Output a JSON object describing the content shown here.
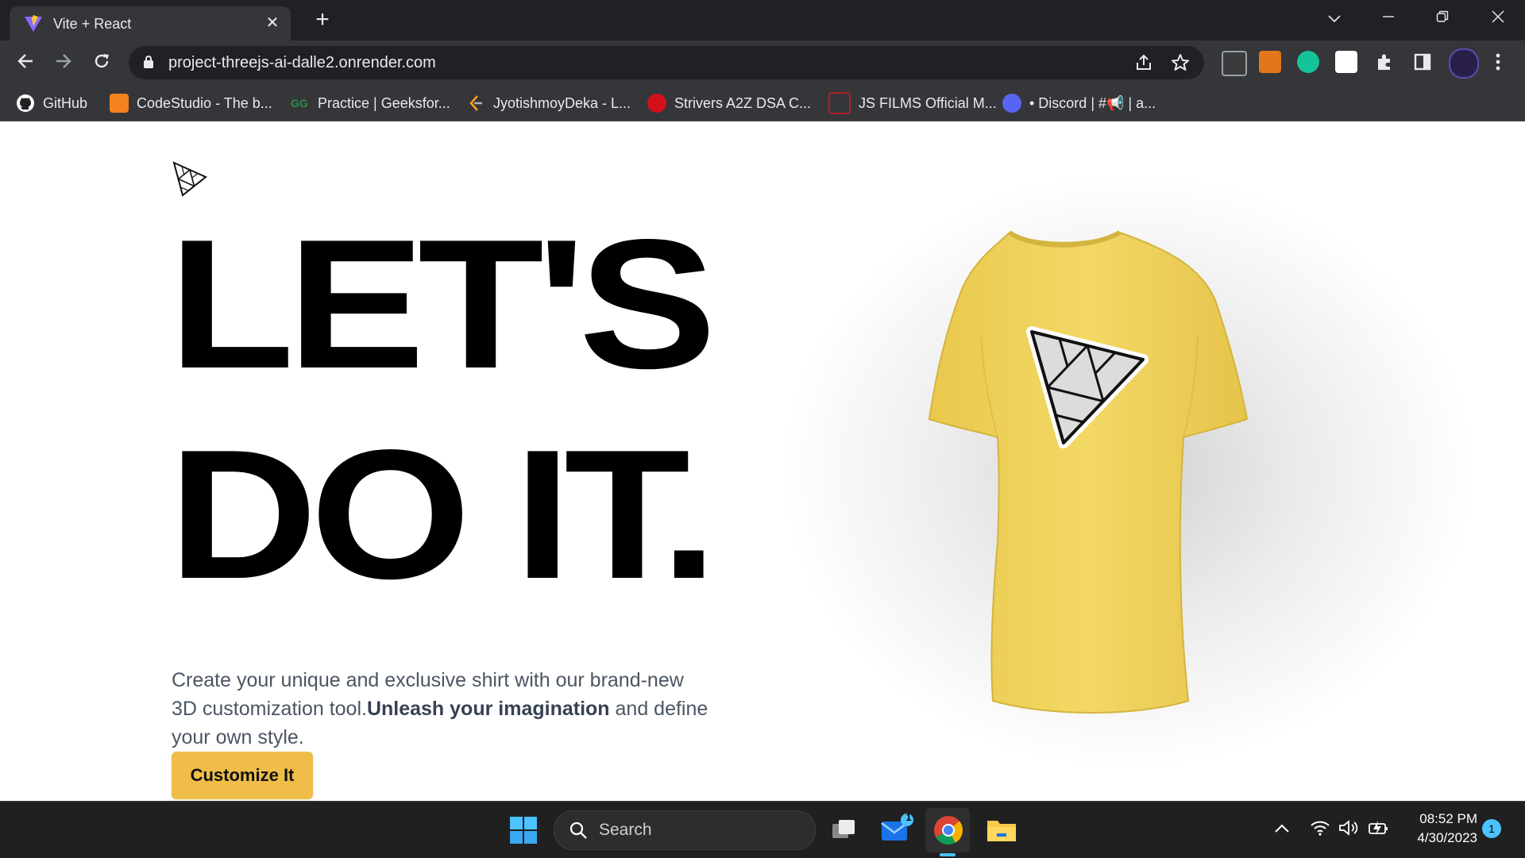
{
  "browser": {
    "tab": {
      "title": "Vite + React",
      "close_symbol": "✕"
    },
    "new_tab_symbol": "+",
    "url": "project-threejs-ai-dalle2.onrender.com",
    "bookmarks": [
      {
        "label": "GitHub",
        "icon": "github-icon",
        "color": "#ffffff"
      },
      {
        "label": "CodeStudio - The b...",
        "icon": "codestudio-icon",
        "color": "#f58220"
      },
      {
        "label": "Practice | Geeksfor...",
        "icon": "geeksforgeeks-icon",
        "color": "#2f8d46"
      },
      {
        "label": "JyotishmoyDeka - L...",
        "icon": "leetcode-icon",
        "color": "#ffa116"
      },
      {
        "label": "Strivers A2Z DSA C...",
        "icon": "tuf-icon",
        "color": "#d4111b"
      },
      {
        "label": "JS FILMS Official M...",
        "icon": "jsfilms-icon",
        "color": "#b22222"
      },
      {
        "label": "• Discord | #📢 | a...",
        "icon": "discord-icon",
        "color": "#5865f2"
      }
    ]
  },
  "page": {
    "headline_line1": "LET'S",
    "headline_line2": "DO IT.",
    "description_part1": "Create your unique and exclusive shirt with our brand-new 3D customization tool.",
    "description_bold": "Unleash your imagination",
    "description_part2": " and define your own style.",
    "cta_label": "Customize It",
    "shirt_color": "#efd159",
    "accent_color": "#efbd48"
  },
  "taskbar": {
    "search_placeholder": "Search",
    "mail_badge": "1",
    "time": "08:52 PM",
    "date": "4/30/2023",
    "notification_count": "1"
  }
}
